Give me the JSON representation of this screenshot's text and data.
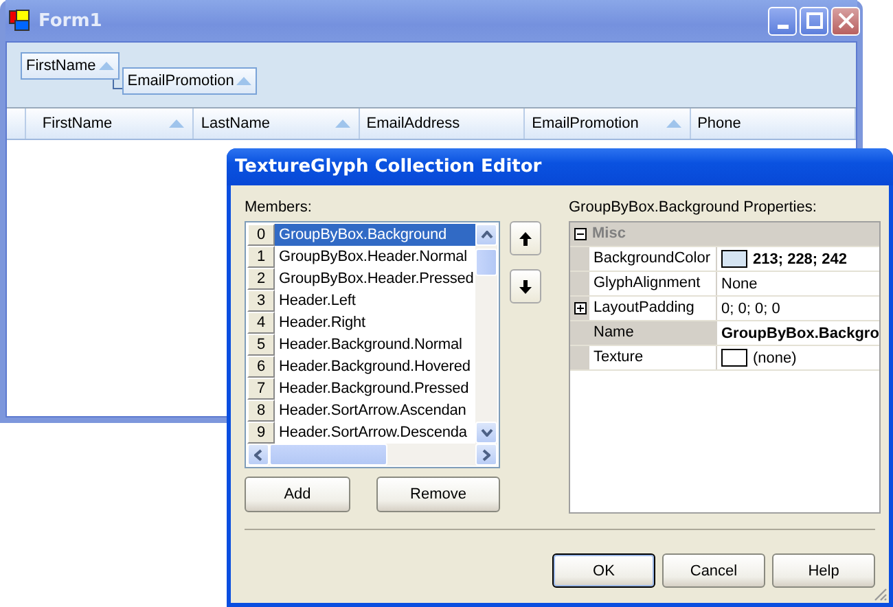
{
  "form": {
    "title": "Form1",
    "group_by": [
      {
        "label": "FirstName"
      },
      {
        "label": "EmailPromotion"
      }
    ],
    "columns": [
      {
        "label": "FirstName",
        "sorted": true
      },
      {
        "label": "LastName",
        "sorted": true
      },
      {
        "label": "EmailAddress",
        "sorted": false
      },
      {
        "label": "EmailPromotion",
        "sorted": true
      },
      {
        "label": "Phone",
        "sorted": false
      }
    ]
  },
  "dialog": {
    "title": "TextureGlyph Collection Editor",
    "members_label": "Members:",
    "members": [
      {
        "index": "0",
        "label": "GroupByBox.Background",
        "selected": true
      },
      {
        "index": "1",
        "label": "GroupByBox.Header.Normal",
        "selected": false
      },
      {
        "index": "2",
        "label": "GroupByBox.Header.Pressed",
        "selected": false
      },
      {
        "index": "3",
        "label": "Header.Left",
        "selected": false
      },
      {
        "index": "4",
        "label": "Header.Right",
        "selected": false
      },
      {
        "index": "5",
        "label": "Header.Background.Normal",
        "selected": false
      },
      {
        "index": "6",
        "label": "Header.Background.Hovered",
        "selected": false
      },
      {
        "index": "7",
        "label": "Header.Background.Pressed",
        "selected": false
      },
      {
        "index": "8",
        "label": "Header.SortArrow.Ascendan",
        "selected": false
      },
      {
        "index": "9",
        "label": "Header.SortArrow.Descenda",
        "selected": false
      }
    ],
    "list_buttons": [
      "Add",
      "Remove"
    ],
    "properties_label": "GroupByBox.Background Properties:",
    "category": {
      "label": "Misc",
      "expanded": true
    },
    "properties": [
      {
        "name": "BackgroundColor",
        "value": "213; 228; 242",
        "bold": true,
        "color": "#d5e4f2",
        "expandable": false,
        "selected": false
      },
      {
        "name": "GlyphAlignment",
        "value": "None",
        "bold": false,
        "expandable": false,
        "selected": false
      },
      {
        "name": "LayoutPadding",
        "value": "0; 0; 0; 0",
        "bold": false,
        "expandable": true,
        "selected": false
      },
      {
        "name": "Name",
        "value": "GroupByBox.Backgro",
        "bold": true,
        "expandable": false,
        "selected": true
      },
      {
        "name": "Texture",
        "value": "(none)",
        "bold": false,
        "color": "#ffffff",
        "expandable": false,
        "selected": false
      }
    ],
    "buttons": [
      {
        "label": "OK",
        "default": true
      },
      {
        "label": "Cancel",
        "default": false
      },
      {
        "label": "Help",
        "default": false
      }
    ]
  }
}
